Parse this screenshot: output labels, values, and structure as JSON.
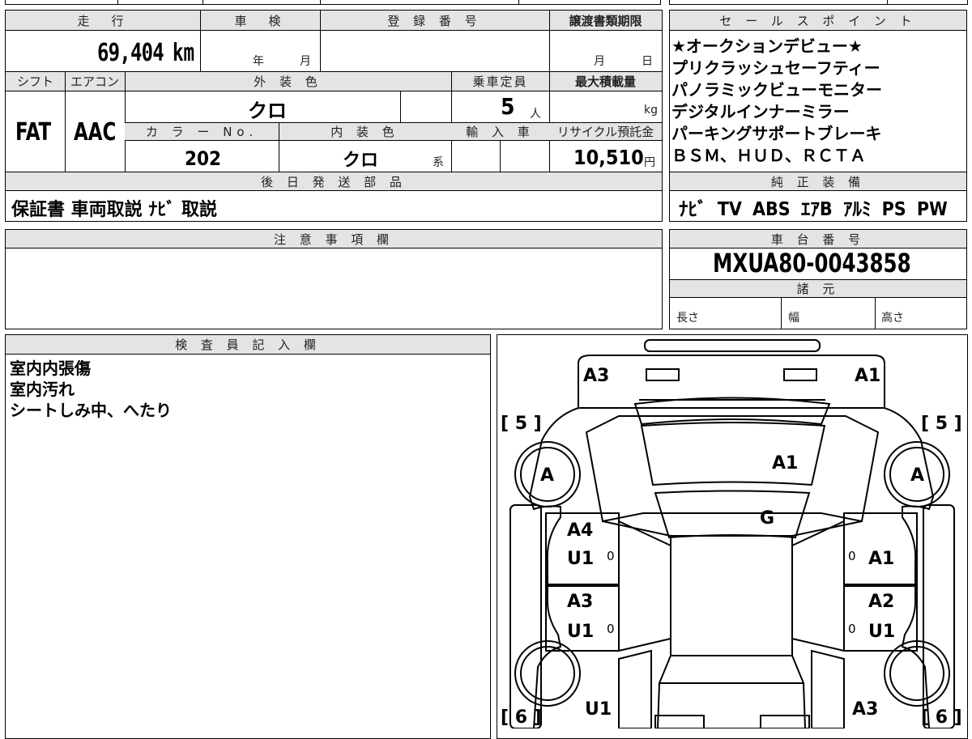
{
  "vehicle": {
    "mileage_label": "走　行",
    "mileage": "69,404",
    "mileage_unit": "km",
    "shaken_label": "車　検",
    "shaken_year_unit": "年",
    "shaken_month_unit": "月",
    "reg_label": "登 録 番 号",
    "deadline_label": "譲渡書類期限",
    "deadline_month_unit": "月",
    "deadline_day_unit": "日",
    "shift_label": "シフト",
    "shift": "FAT",
    "ac_label": "エアコン",
    "ac": "AAC",
    "ext_color_label": "外 装 色",
    "ext_color": "クロ",
    "capacity_label": "乗車定員",
    "capacity": "5",
    "capacity_unit": "人",
    "maxload_label": "最大積載量",
    "maxload_unit": "kg",
    "color_no_label": "カ ラ ー No.",
    "color_no": "202",
    "int_color_label": "内 装 色",
    "int_color": "クロ",
    "int_color_unit": "系",
    "import_label": "輸 入 車",
    "recycle_label": "リサイクル預託金",
    "recycle": "10,510",
    "recycle_unit": "円"
  },
  "later_parts": {
    "label": "後 日 発 送 部 品",
    "value": "保証書 車両取説 ﾅﾋﾞ 取説"
  },
  "notes": {
    "label": "注 意 事 項 欄"
  },
  "sales_points": {
    "label": "セ ー ル ス ポ イ ン ト",
    "lines": [
      "★オークションデビュー★",
      "プリクラッシュセーフティー",
      "パノラミックビューモニター",
      "デジタルインナーミラー",
      "パーキングサポートブレーキ",
      "ＢＳＭ、ＨＵＤ、ＲＣＴＡ"
    ]
  },
  "equipment": {
    "label": "純 正 装 備",
    "value": "ﾅﾋﾞ TV ABS ｴｱB ｱﾙﾐ PS PW"
  },
  "chassis": {
    "label": "車 台 番 号",
    "value": "MXUA80-0043858"
  },
  "specs": {
    "label": "諸 元",
    "length_label": "長さ",
    "width_label": "幅",
    "height_label": "高さ"
  },
  "inspector": {
    "label": "検 査 員 記 入 欄",
    "lines": [
      "室内内張傷",
      "室内汚れ",
      "シートしみ中、へたり"
    ]
  },
  "diagram": {
    "front_left_tag": "[ 5 ]",
    "front_right_tag": "[ 5 ]",
    "rear_left_tag": "[ 6 ]",
    "rear_right_tag": "[ 6 ]",
    "marks": {
      "front_bumper_left": "A3",
      "front_bumper_right": "A1",
      "hood": "A1",
      "windshield": "G",
      "left_front_wheel": "A",
      "right_front_wheel": "A",
      "left_front_door_1": "A4",
      "left_front_door_2": "U1",
      "left_front_door_small": "0",
      "right_front_door_small": "0",
      "right_front_door": "A1",
      "left_rear_door_1": "A3",
      "left_rear_door_2": "U1",
      "left_rear_door_small": "0",
      "right_rear_door_1": "A2",
      "right_rear_door_small": "0",
      "right_rear_door_2": "U1",
      "left_rear_quarter": "U1",
      "right_rear_quarter": "A3"
    }
  }
}
